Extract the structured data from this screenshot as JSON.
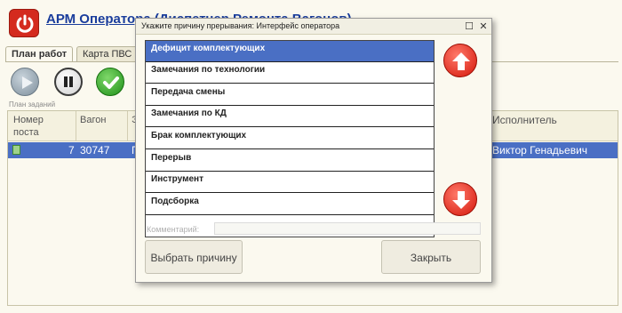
{
  "app": {
    "title": "АРМ Оператора (Диспетчер Ремонта Вагонов)",
    "tabs": [
      "План работ",
      "Карта ПВС"
    ],
    "group_label": "План заданий",
    "grid": {
      "headers": [
        "Номер\nпоста",
        "Вагон",
        "Э",
        "Исполнитель"
      ],
      "row": {
        "post": "7",
        "wagon": "30747",
        "col3": "П",
        "executor": "Виктор Генадьевич"
      }
    },
    "colors": {
      "accent": "#4a6fc4",
      "title": "#1a3d9c",
      "power": "#d42a1e"
    }
  },
  "icons": [
    "power-icon",
    "play-icon",
    "pause-icon",
    "check-icon",
    "arrow-up-icon",
    "arrow-down-icon"
  ],
  "dialog": {
    "title": "Укажите причину прерывания: Интерфейс оператора",
    "reasons": [
      "Дефицит комплектующих",
      "Замечания по технологии",
      "Передача смены",
      "Замечания по КД",
      "Брак комплектующих",
      "Перерыв",
      "Инструмент",
      "Подсборка"
    ],
    "selected_reason": "Дефицит комплектующих",
    "comment_label": "Комментарий:",
    "comment_value": "",
    "choose_button": "Выбрать причину",
    "close_button": "Закрыть"
  }
}
